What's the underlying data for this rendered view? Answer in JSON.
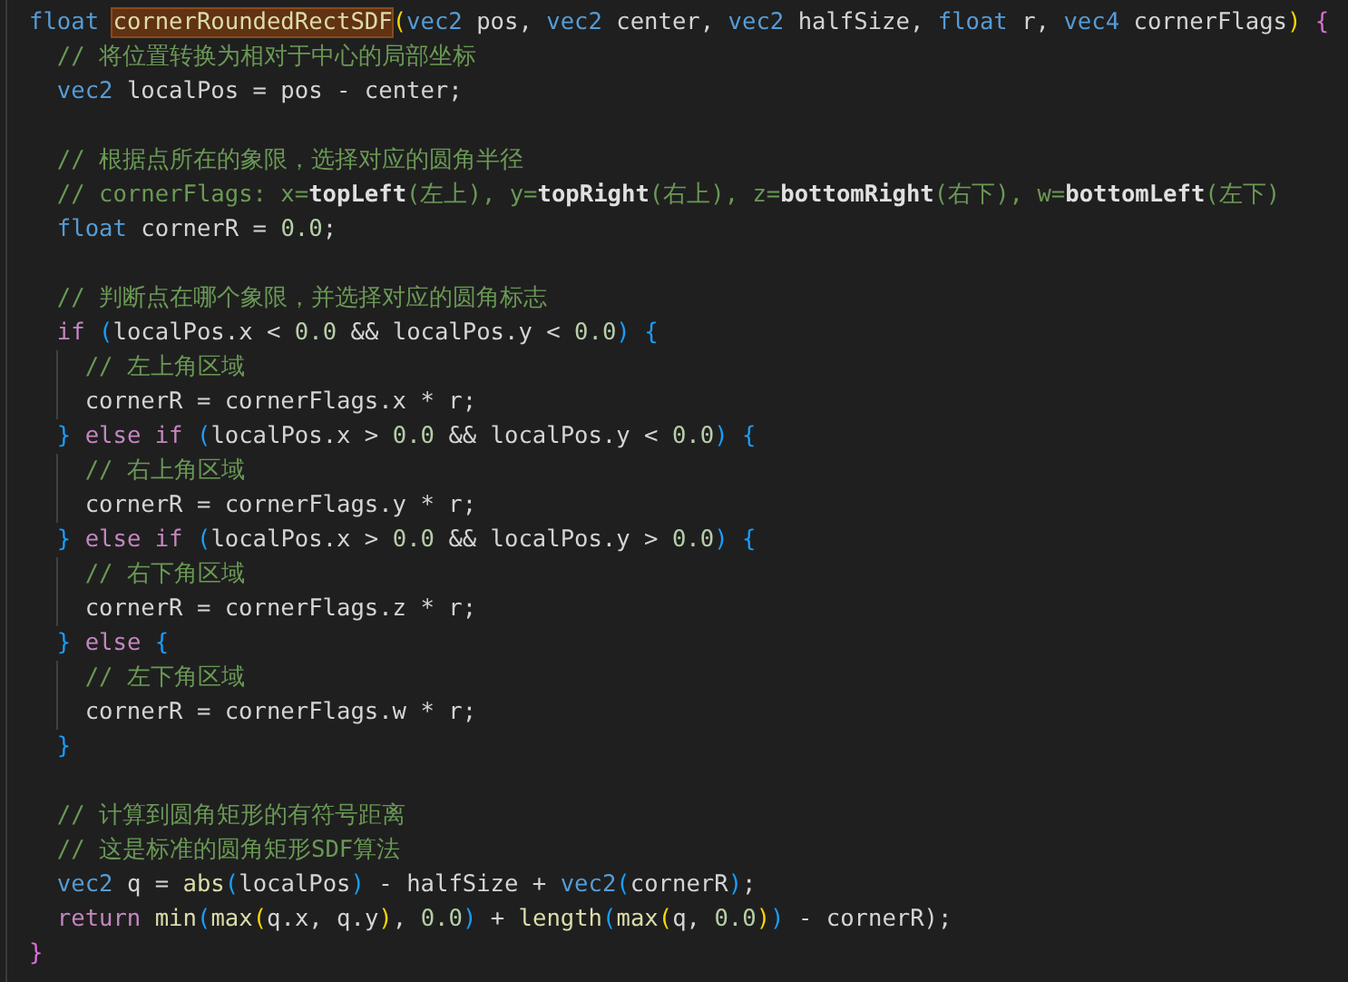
{
  "editor": {
    "lines": [
      {
        "kind": "code",
        "tokens": [
          {
            "kind": "kw",
            "text": "float "
          },
          {
            "kind": "match",
            "text": "cornerRoundedRectSDF"
          },
          {
            "kind": "b1",
            "text": "("
          },
          {
            "kind": "kw",
            "text": "vec2"
          },
          {
            "kind": "id",
            "text": " pos, "
          },
          {
            "kind": "kw",
            "text": "vec2"
          },
          {
            "kind": "id",
            "text": " center, "
          },
          {
            "kind": "kw",
            "text": "vec2"
          },
          {
            "kind": "id",
            "text": " halfSize, "
          },
          {
            "kind": "kw",
            "text": "float"
          },
          {
            "kind": "id",
            "text": " r, "
          },
          {
            "kind": "kw",
            "text": "vec4"
          },
          {
            "kind": "id",
            "text": " cornerFlags"
          },
          {
            "kind": "b1",
            "text": ") "
          },
          {
            "kind": "b2",
            "text": "{"
          }
        ],
        "children": [
          {
            "kind": "code",
            "tokens": [
              {
                "kind": "cm",
                "text": "// 将位置转换为相对于中心的局部坐标"
              }
            ]
          },
          {
            "kind": "code",
            "tokens": [
              {
                "kind": "kw",
                "text": "vec2"
              },
              {
                "kind": "id",
                "text": " localPos = pos - center;"
              }
            ]
          },
          {
            "kind": "blank"
          },
          {
            "kind": "code",
            "tokens": [
              {
                "kind": "cm",
                "text": "// 根据点所在的象限，选择对应的圆角半径"
              }
            ]
          },
          {
            "kind": "code",
            "tokens": [
              {
                "kind": "cm",
                "text": "// cornerFlags: x="
              },
              {
                "kind": "cmb",
                "text": "topLeft"
              },
              {
                "kind": "cm",
                "text": "(左上), y="
              },
              {
                "kind": "cmb",
                "text": "topRight"
              },
              {
                "kind": "cm",
                "text": "(右上), z="
              },
              {
                "kind": "cmb",
                "text": "bottomRight"
              },
              {
                "kind": "cm",
                "text": "(右下), w="
              },
              {
                "kind": "cmb",
                "text": "bottomLeft"
              },
              {
                "kind": "cm",
                "text": "(左下)"
              }
            ]
          },
          {
            "kind": "code",
            "tokens": [
              {
                "kind": "kw",
                "text": "float"
              },
              {
                "kind": "id",
                "text": " cornerR = "
              },
              {
                "kind": "num",
                "text": "0.0"
              },
              {
                "kind": "id",
                "text": ";"
              }
            ]
          },
          {
            "kind": "blank"
          },
          {
            "kind": "code",
            "tokens": [
              {
                "kind": "cm",
                "text": "// 判断点在哪个象限，并选择对应的圆角标志"
              }
            ]
          },
          {
            "kind": "code",
            "tokens": [
              {
                "kind": "ctl",
                "text": "if "
              },
              {
                "kind": "b3",
                "text": "("
              },
              {
                "kind": "id",
                "text": "localPos.x < "
              },
              {
                "kind": "num",
                "text": "0.0"
              },
              {
                "kind": "id",
                "text": " && localPos.y < "
              },
              {
                "kind": "num",
                "text": "0.0"
              },
              {
                "kind": "b3",
                "text": ") {"
              }
            ],
            "children": [
              {
                "kind": "code",
                "tokens": [
                  {
                    "kind": "cm",
                    "text": "// 左上角区域"
                  }
                ]
              },
              {
                "kind": "code",
                "tokens": [
                  {
                    "kind": "id",
                    "text": "cornerR = cornerFlags.x * r;"
                  }
                ]
              }
            ]
          },
          {
            "kind": "code",
            "tokens": [
              {
                "kind": "b3",
                "text": "} "
              },
              {
                "kind": "ctl",
                "text": "else if "
              },
              {
                "kind": "b3",
                "text": "("
              },
              {
                "kind": "id",
                "text": "localPos.x > "
              },
              {
                "kind": "num",
                "text": "0.0"
              },
              {
                "kind": "id",
                "text": " && localPos.y < "
              },
              {
                "kind": "num",
                "text": "0.0"
              },
              {
                "kind": "b3",
                "text": ") {"
              }
            ],
            "children": [
              {
                "kind": "code",
                "tokens": [
                  {
                    "kind": "cm",
                    "text": "// 右上角区域"
                  }
                ]
              },
              {
                "kind": "code",
                "tokens": [
                  {
                    "kind": "id",
                    "text": "cornerR = cornerFlags.y * r;"
                  }
                ]
              }
            ]
          },
          {
            "kind": "code",
            "tokens": [
              {
                "kind": "b3",
                "text": "} "
              },
              {
                "kind": "ctl",
                "text": "else if "
              },
              {
                "kind": "b3",
                "text": "("
              },
              {
                "kind": "id",
                "text": "localPos.x > "
              },
              {
                "kind": "num",
                "text": "0.0"
              },
              {
                "kind": "id",
                "text": " && localPos.y > "
              },
              {
                "kind": "num",
                "text": "0.0"
              },
              {
                "kind": "b3",
                "text": ") {"
              }
            ],
            "children": [
              {
                "kind": "code",
                "tokens": [
                  {
                    "kind": "cm",
                    "text": "// 右下角区域"
                  }
                ]
              },
              {
                "kind": "code",
                "tokens": [
                  {
                    "kind": "id",
                    "text": "cornerR = cornerFlags.z * r;"
                  }
                ]
              }
            ]
          },
          {
            "kind": "code",
            "tokens": [
              {
                "kind": "b3",
                "text": "} "
              },
              {
                "kind": "ctl",
                "text": "else "
              },
              {
                "kind": "b3",
                "text": "{"
              }
            ],
            "children": [
              {
                "kind": "code",
                "tokens": [
                  {
                    "kind": "cm",
                    "text": "// 左下角区域"
                  }
                ]
              },
              {
                "kind": "code",
                "tokens": [
                  {
                    "kind": "id",
                    "text": "cornerR = cornerFlags.w * r;"
                  }
                ]
              }
            ]
          },
          {
            "kind": "code",
            "tokens": [
              {
                "kind": "b3",
                "text": "}"
              }
            ]
          },
          {
            "kind": "blank"
          },
          {
            "kind": "code",
            "tokens": [
              {
                "kind": "cm",
                "text": "// 计算到圆角矩形的有符号距离"
              }
            ]
          },
          {
            "kind": "code",
            "tokens": [
              {
                "kind": "cm",
                "text": "// 这是标准的圆角矩形SDF算法"
              }
            ]
          },
          {
            "kind": "code",
            "tokens": [
              {
                "kind": "kw",
                "text": "vec2"
              },
              {
                "kind": "id",
                "text": " q = "
              },
              {
                "kind": "fn",
                "text": "abs"
              },
              {
                "kind": "b3",
                "text": "("
              },
              {
                "kind": "id",
                "text": "localPos"
              },
              {
                "kind": "b3",
                "text": ")"
              },
              {
                "kind": "id",
                "text": " - halfSize + "
              },
              {
                "kind": "kw",
                "text": "vec2"
              },
              {
                "kind": "b3",
                "text": "("
              },
              {
                "kind": "id",
                "text": "cornerR"
              },
              {
                "kind": "b3",
                "text": ")"
              },
              {
                "kind": "id",
                "text": ";"
              }
            ]
          },
          {
            "kind": "code",
            "tokens": [
              {
                "kind": "ctl",
                "text": "return "
              },
              {
                "kind": "fn",
                "text": "min"
              },
              {
                "kind": "b3",
                "text": "("
              },
              {
                "kind": "fn",
                "text": "max"
              },
              {
                "kind": "b1",
                "text": "("
              },
              {
                "kind": "id",
                "text": "q.x, q.y"
              },
              {
                "kind": "b1",
                "text": ")"
              },
              {
                "kind": "id",
                "text": ", "
              },
              {
                "kind": "num",
                "text": "0.0"
              },
              {
                "kind": "b3",
                "text": ")"
              },
              {
                "kind": "id",
                "text": " + "
              },
              {
                "kind": "fn",
                "text": "length"
              },
              {
                "kind": "b3",
                "text": "("
              },
              {
                "kind": "fn",
                "text": "max"
              },
              {
                "kind": "b1",
                "text": "("
              },
              {
                "kind": "id",
                "text": "q, "
              },
              {
                "kind": "num",
                "text": "0.0"
              },
              {
                "kind": "b1",
                "text": ")"
              },
              {
                "kind": "b3",
                "text": ")"
              },
              {
                "kind": "id",
                "text": " - cornerR);"
              }
            ]
          }
        ]
      },
      {
        "kind": "code",
        "tokens": [
          {
            "kind": "b2",
            "text": "}"
          }
        ]
      }
    ]
  }
}
